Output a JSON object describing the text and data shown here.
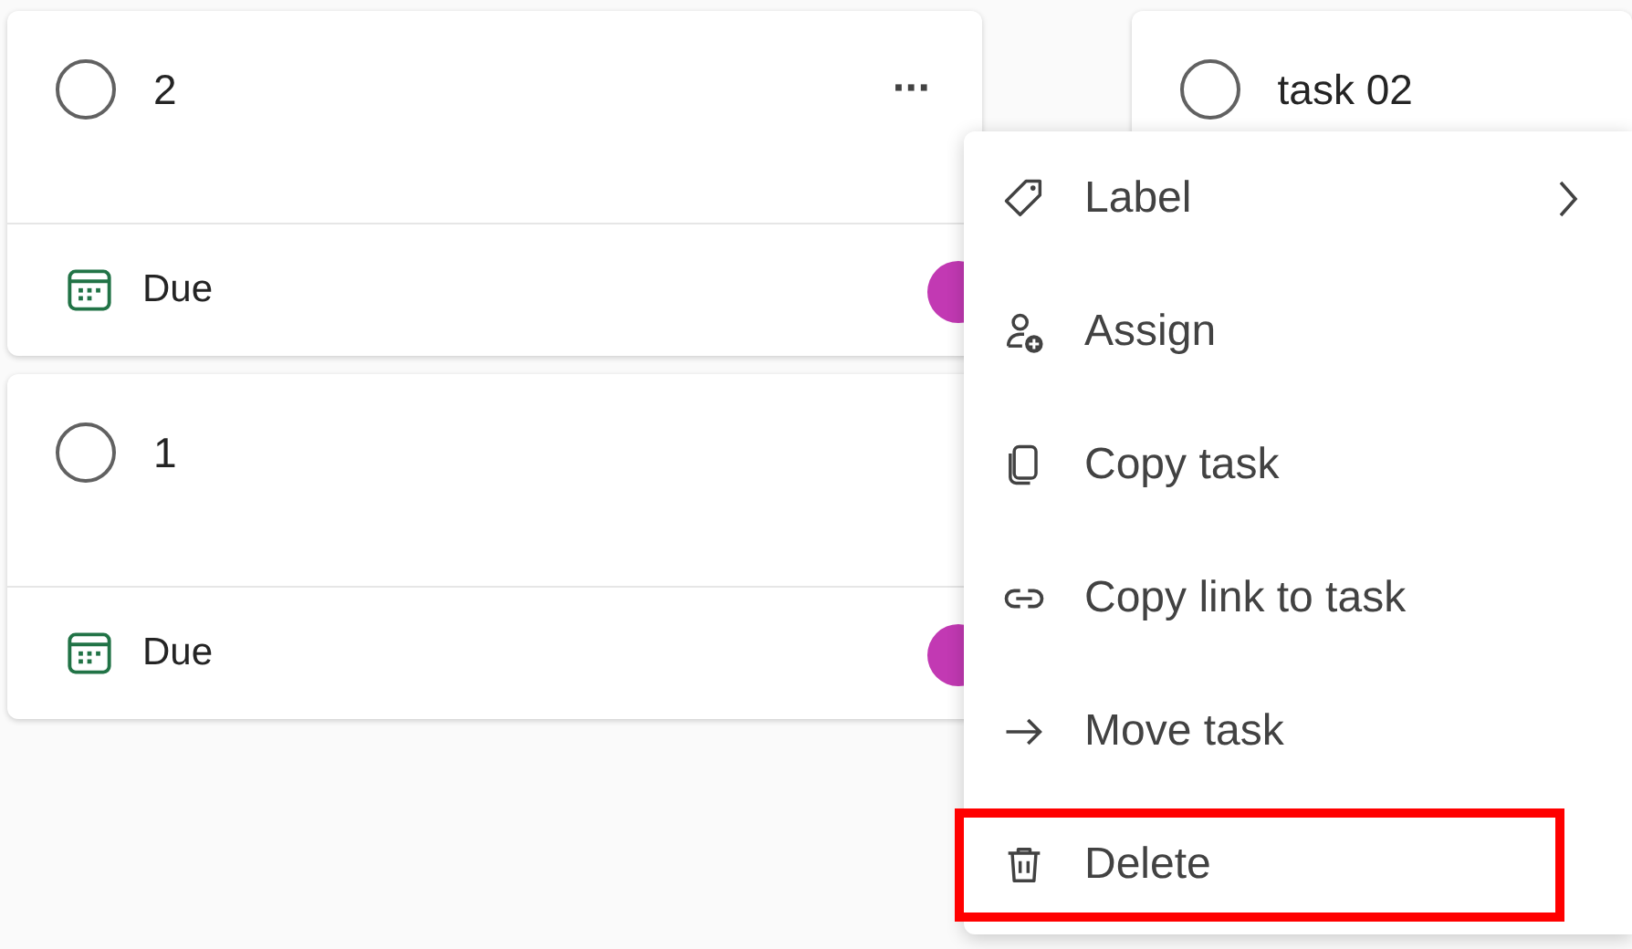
{
  "columns": [
    {
      "tasks": [
        {
          "title": "2",
          "completed": false,
          "due": "Due",
          "avatar": {
            "color": "#c239b3"
          },
          "more_button": "···"
        },
        {
          "title": "1",
          "completed": false,
          "due": "Due",
          "avatar": {
            "color": "#c239b3"
          }
        }
      ]
    },
    {
      "tasks": [
        {
          "title": "task 02",
          "completed": false
        }
      ]
    }
  ],
  "context_menu": {
    "items": [
      {
        "label": "Label",
        "kind": "submenu",
        "highlighted": false
      },
      {
        "label": "Assign",
        "kind": "action",
        "highlighted": false
      },
      {
        "label": "Copy task",
        "kind": "action",
        "highlighted": false
      },
      {
        "label": "Copy link to task",
        "kind": "action",
        "highlighted": false
      },
      {
        "label": "Move task",
        "kind": "action",
        "highlighted": false
      },
      {
        "label": "Delete",
        "kind": "action",
        "highlighted": true
      }
    ]
  }
}
